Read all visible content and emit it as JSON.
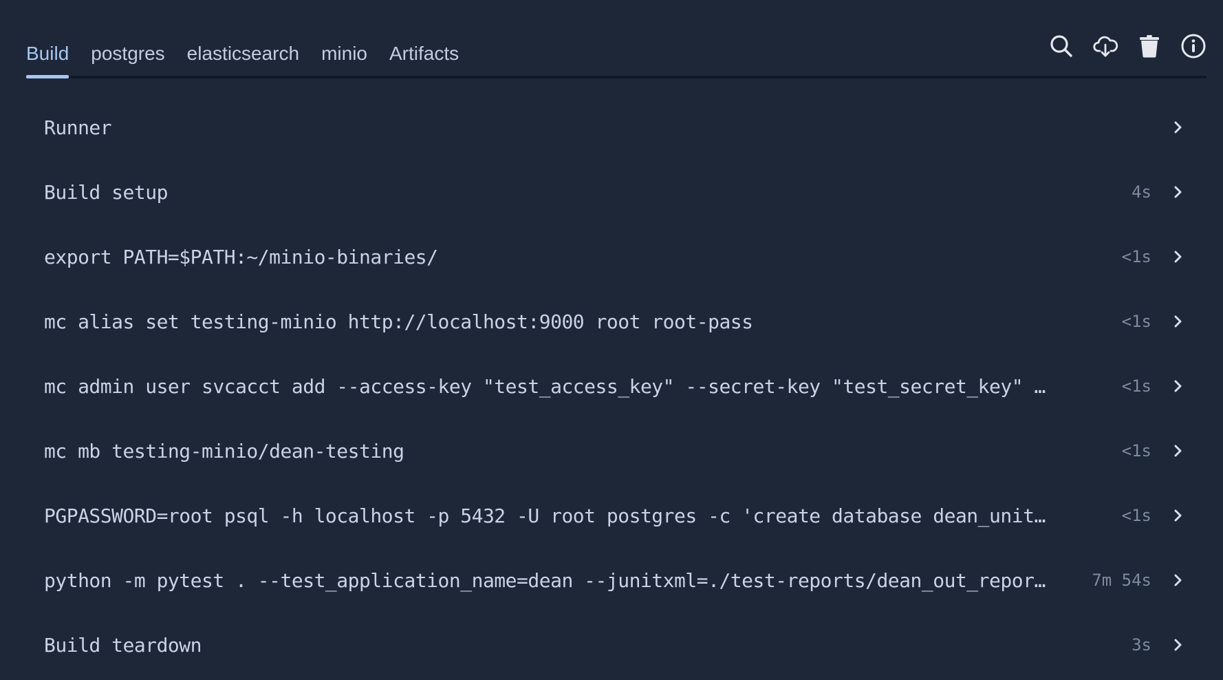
{
  "tabs": [
    {
      "label": "Build",
      "active": true
    },
    {
      "label": "postgres",
      "active": false
    },
    {
      "label": "elasticsearch",
      "active": false
    },
    {
      "label": "minio",
      "active": false
    },
    {
      "label": "Artifacts",
      "active": false
    }
  ],
  "actions": [
    {
      "name": "search",
      "icon": "search-icon"
    },
    {
      "name": "download",
      "icon": "cloud-download-icon"
    },
    {
      "name": "delete",
      "icon": "trash-icon"
    },
    {
      "name": "info",
      "icon": "info-icon"
    }
  ],
  "steps": [
    {
      "name": "Runner",
      "duration": ""
    },
    {
      "name": "Build setup",
      "duration": "4s"
    },
    {
      "name": "export PATH=$PATH:~/minio-binaries/",
      "duration": "<1s"
    },
    {
      "name": "mc alias set testing-minio http://localhost:9000 root root-pass",
      "duration": "<1s"
    },
    {
      "name": "mc admin user svcacct add --access-key \"test_access_key\" --secret-key \"test_secret_key\" …",
      "duration": "<1s"
    },
    {
      "name": "mc mb testing-minio/dean-testing",
      "duration": "<1s"
    },
    {
      "name": "PGPASSWORD=root psql -h localhost -p 5432 -U root postgres -c 'create database dean_unit…",
      "duration": "<1s"
    },
    {
      "name": "python -m pytest . --test_application_name=dean --junitxml=./test-reports/dean_out_repor…",
      "duration": "7m 54s"
    },
    {
      "name": "Build teardown",
      "duration": "3s"
    }
  ],
  "colors": {
    "background": "#1d2738",
    "accent": "#a7c7f2",
    "text": "#c9d3e6",
    "muted": "#7e8aa0",
    "divider": "#111827"
  }
}
